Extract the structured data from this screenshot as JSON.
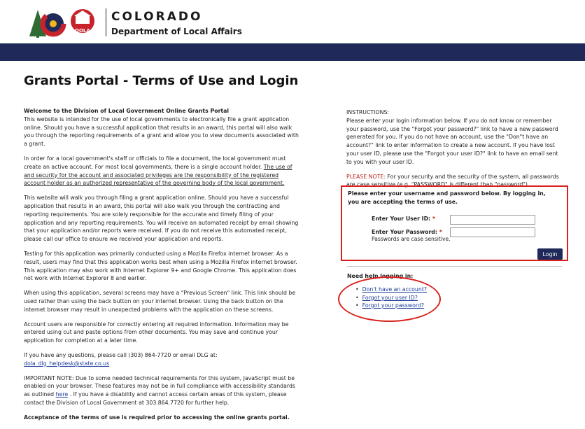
{
  "header": {
    "logo_text": "DOLA",
    "state_name": "COLORADO",
    "department": "Department of Local Affairs"
  },
  "page_title": "Grants Portal - Terms of Use and Login",
  "left": {
    "welcome_heading": "Welcome to the Division of Local Government Online Grants Portal",
    "welcome_body": "This website is intended for the use of local governments to electronically file a grant application online. Should you have a successful application that results in an award, this portal will also walk you through the reporting requirements of a grant and allow you to view documents associated with a grant.",
    "account_p_start": "In order for a local government's staff or officials to file a document, the local government must create an active account. For most local governments, there is a single account holder. ",
    "account_p_underlined": "The use of and security for the account and associated privileges are the responsibility of the registered account holder as an authorized representative of the governing body of the local government.",
    "walkthrough_p": "This website will walk you through filing a grant application online. Should you have a successful application that results in an award, this portal will also walk you through the contracting and reporting requirements. You are solely responsible for the accurate and timely filing of your application and any reporting requirements. You will receive an automated receipt by email showing that your application and/or reports were received. If you do not receive this automated receipt, please call our office to ensure we received your application and reports.",
    "testing_p": "Testing for this application was primarily conducted using a Mozilla Firefox internet browser. As a result, users may find that this application works best when using a Mozilla Firefox internet browser. This application may also work with Internet Explorer 9+ and Google Chrome. This application does not work with Internet Explorer 8 and earlier.",
    "previous_screen_p": "When using this application, several screens may have a \"Previous Screen\" link. This link should be used rather than using the back button on your internet browser. Using the back button on the internet browser may result in unexpected problems with the application on these screens.",
    "responsibility_p": "Account users are responsible for correctly entering all required information. Information may be entered using cut and paste options from other documents. You may save and continue your application for completion at a later time.",
    "questions_p_start": "If you have any questions, please call (303) 864-7720 or email DLG at: ",
    "questions_email": "dola_dlg_helpdesk@state.co.us",
    "important_p_start": "IMPORTANT NOTE: Due to some needed technical requirements for this system, JavaScript must be enabled on your browser. These features may not be in full compliance with accessibility standards as outlined ",
    "important_link": "here",
    "important_p_end": " . If you have a disability and cannot access certain areas of this system, please contact the Division of Local Government at 303.864.7720 for further help.",
    "acceptance": "Acceptance of the terms of use is required prior to accessing the online grants portal."
  },
  "right": {
    "instructions_heading": "INSTRUCTIONS:",
    "instructions_body": "Please enter your login information below. If you do not know or remember your password, use the \"Forgot your password?\" link to have a new password generated for you. If you do not have an account, use the \"Don\"t have an account?\" link to enter information to create a new account. If you have lost your user ID, please use the \"Forgot your user ID?\" link to have an email sent to you with your user ID.",
    "note_label": "PLEASE NOTE:",
    "note_body": " For your security and the security of the system, all passwords are case sensitive (e.g. \"PASSWORD\" is different than \"password\")."
  },
  "login": {
    "message": "Please enter your username and password below. By logging in, you are accepting the terms of use.",
    "user_id_label": "Enter Your User ID:",
    "password_label": "Enter Your Password:",
    "required_mark": "*",
    "password_hint": "Passwords are case sensitive.",
    "user_id_value": "",
    "password_value": "",
    "button_label": "Login"
  },
  "help": {
    "title": "Need help logging in:",
    "links": [
      "Don't have an account?",
      "Forgot your user ID?",
      "Forgot your password?"
    ]
  },
  "colors": {
    "navbar": "#1f2a5a",
    "annotation_red": "#d9211c",
    "link_blue": "#1a3a9a"
  }
}
